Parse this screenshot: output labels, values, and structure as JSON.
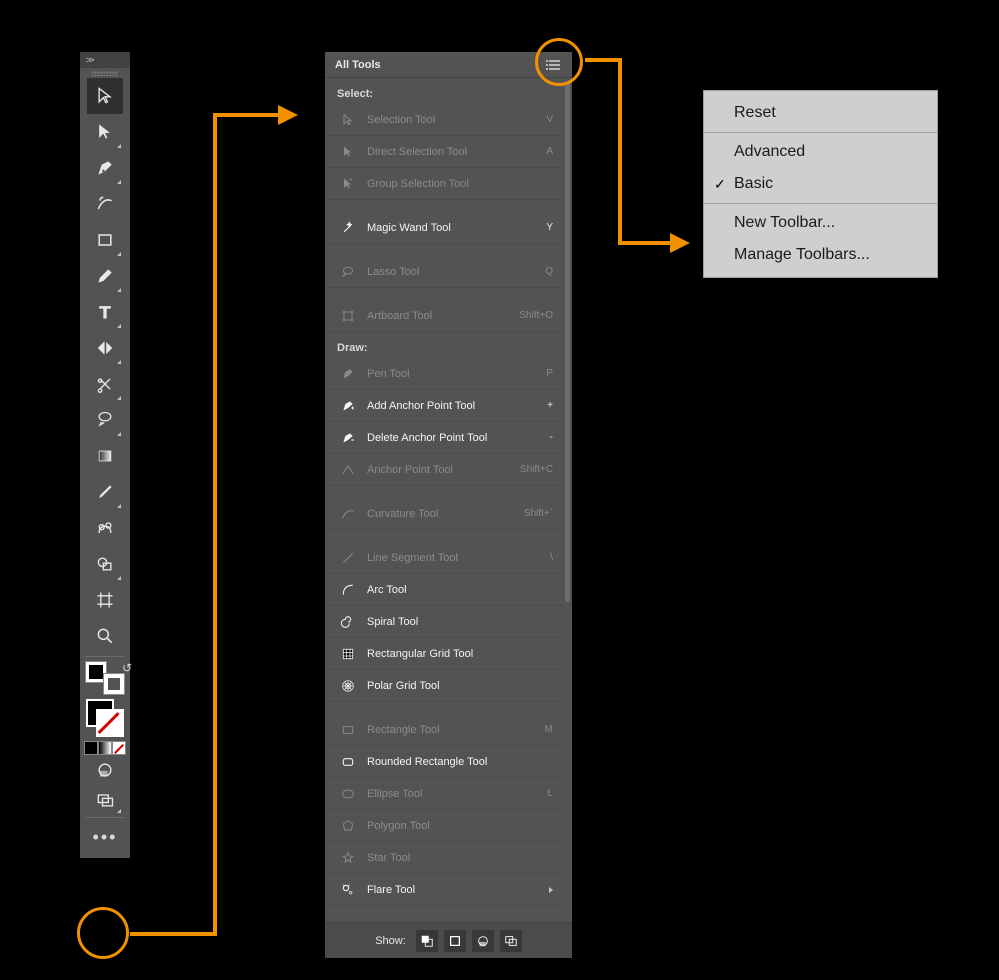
{
  "toolbar": {
    "header_chevrons": ">>",
    "tools": [
      {
        "name": "selection-tool",
        "active": true,
        "fly": false
      },
      {
        "name": "direct-selection-tool",
        "active": false,
        "fly": true
      },
      {
        "name": "pen-tool",
        "active": false,
        "fly": true
      },
      {
        "name": "curvature-tool",
        "active": false,
        "fly": false
      },
      {
        "name": "rectangle-tool",
        "active": false,
        "fly": true
      },
      {
        "name": "paintbrush-tool",
        "active": false,
        "fly": true
      },
      {
        "name": "type-tool",
        "active": false,
        "fly": true
      },
      {
        "name": "rotate-tool",
        "active": false,
        "fly": true
      },
      {
        "name": "scissors-tool",
        "active": false,
        "fly": true
      },
      {
        "name": "width-tool",
        "active": false,
        "fly": true
      },
      {
        "name": "gradient-tool",
        "active": false,
        "fly": false
      },
      {
        "name": "eyedropper-tool",
        "active": false,
        "fly": true
      },
      {
        "name": "blend-tool",
        "active": false,
        "fly": false
      },
      {
        "name": "shape-builder-tool",
        "active": false,
        "fly": true
      },
      {
        "name": "artboard-tool",
        "active": false,
        "fly": false
      },
      {
        "name": "zoom-tool",
        "active": false,
        "fly": false
      }
    ],
    "more_label": "•••"
  },
  "all_tools": {
    "title": "All Tools",
    "groups": [
      {
        "label": "Select:",
        "items": [
          {
            "name": "selection-tool",
            "label": "Selection Tool",
            "shortcut": "V",
            "bright": false
          },
          {
            "name": "direct-selection-tool",
            "label": "Direct Selection Tool",
            "shortcut": "A",
            "bright": false
          },
          {
            "name": "group-selection-tool",
            "label": "Group Selection Tool",
            "shortcut": "",
            "bright": false
          },
          {
            "name": "magic-wand-tool",
            "label": "Magic Wand Tool",
            "shortcut": "Y",
            "bright": true
          },
          {
            "name": "lasso-tool",
            "label": "Lasso Tool",
            "shortcut": "Q",
            "bright": false
          },
          {
            "name": "artboard-tool",
            "label": "Artboard Tool",
            "shortcut": "Shift+O",
            "bright": false
          }
        ]
      },
      {
        "label": "Draw:",
        "items": [
          {
            "name": "pen-tool",
            "label": "Pen Tool",
            "shortcut": "P",
            "bright": false
          },
          {
            "name": "add-anchor-point-tool",
            "label": "Add Anchor Point Tool",
            "shortcut": "+",
            "bright": true
          },
          {
            "name": "delete-anchor-point-tool",
            "label": "Delete Anchor Point Tool",
            "shortcut": "-",
            "bright": true
          },
          {
            "name": "anchor-point-tool",
            "label": "Anchor Point Tool",
            "shortcut": "Shift+C",
            "bright": false
          },
          {
            "name": "curvature-tool",
            "label": "Curvature Tool",
            "shortcut": "Shift+`",
            "bright": false
          },
          {
            "name": "line-segment-tool",
            "label": "Line Segment Tool",
            "shortcut": "\\",
            "bright": false
          },
          {
            "name": "arc-tool",
            "label": "Arc Tool",
            "shortcut": "",
            "bright": true
          },
          {
            "name": "spiral-tool",
            "label": "Spiral Tool",
            "shortcut": "",
            "bright": true
          },
          {
            "name": "rectangular-grid-tool",
            "label": "Rectangular Grid Tool",
            "shortcut": "",
            "bright": true
          },
          {
            "name": "polar-grid-tool",
            "label": "Polar Grid Tool",
            "shortcut": "",
            "bright": true
          },
          {
            "name": "rectangle-tool",
            "label": "Rectangle Tool",
            "shortcut": "M",
            "bright": false
          },
          {
            "name": "rounded-rectangle-tool",
            "label": "Rounded Rectangle Tool",
            "shortcut": "",
            "bright": true
          },
          {
            "name": "ellipse-tool",
            "label": "Ellipse Tool",
            "shortcut": "L",
            "bright": false
          },
          {
            "name": "polygon-tool",
            "label": "Polygon Tool",
            "shortcut": "",
            "bright": false
          },
          {
            "name": "star-tool",
            "label": "Star Tool",
            "shortcut": "",
            "bright": false
          },
          {
            "name": "flare-tool",
            "label": "Flare Tool",
            "shortcut": "",
            "bright": true,
            "fly": true
          }
        ]
      }
    ],
    "footer_label": "Show:"
  },
  "flyout_menu": {
    "items": [
      {
        "label": "Reset",
        "checked": false,
        "sep_after": true
      },
      {
        "label": "Advanced",
        "checked": false
      },
      {
        "label": "Basic",
        "checked": true,
        "sep_after": true
      },
      {
        "label": "New Toolbar...",
        "checked": false
      },
      {
        "label": "Manage Toolbars...",
        "checked": false
      }
    ]
  }
}
